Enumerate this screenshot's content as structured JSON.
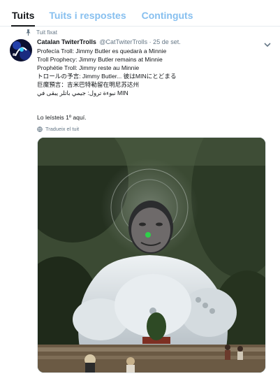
{
  "tabs": [
    {
      "label": "Tuits"
    },
    {
      "label": "Tuits i respostes"
    },
    {
      "label": "Continguts"
    }
  ],
  "tweet": {
    "pinned_label": "Tuit fixat",
    "author_name": "Catalan TwiterTrolls",
    "handle_date": "@CatTwiterTrolls · 25 de set.",
    "lines": [
      "Profecía Troll: Jimmy Butler es quedarà a Minnie",
      "Troll Prophecy: Jimmy Butler remains at Minnie",
      "Prophétie Troll: Jimmy reste au Minnie",
      "トロールの予言: Jimmy Butler... 彼はMINにとどまる",
      "巨魔預言：吉米巴特勒留在明尼苏达州",
      "نبوءة ترول: جيمي باتلر يبقى في MIN"
    ],
    "lead_text": "Lo leísteis 1º aquí.",
    "translate_label": "Tradueix el tuit"
  },
  "colors": {
    "tab_active": "#14171a",
    "tab_inactive": "#86bfef",
    "secondary_text": "#657786",
    "border": "#e6ecf0"
  },
  "icons": [
    "pin-icon",
    "chevron-down-icon",
    "globe-icon"
  ]
}
